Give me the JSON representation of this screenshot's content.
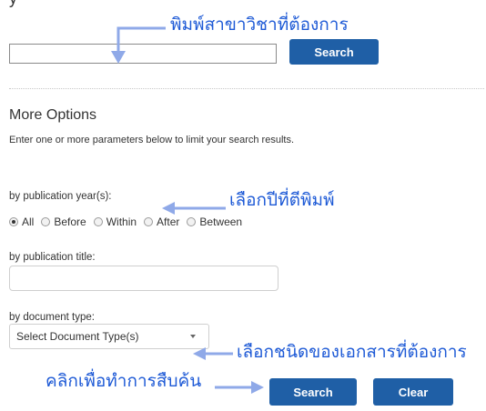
{
  "top": {
    "clipped_title": "y",
    "search_button": "Search"
  },
  "more_options": {
    "title": "More Options",
    "description": "Enter one or more parameters below to limit your search results."
  },
  "year": {
    "label": "by publication year(s):",
    "options": [
      "All",
      "Before",
      "Within",
      "After",
      "Between"
    ],
    "selected": "All"
  },
  "pub_title": {
    "label": "by publication title:",
    "value": ""
  },
  "doc_type": {
    "label": "by document type:",
    "selected": "Select Document Type(s)"
  },
  "actions": {
    "search": "Search",
    "clear": "Clear"
  },
  "annotations": {
    "subject": "พิมพ์สาขาวิชาที่ต้องการ",
    "year": "เลือกปีที่ตีพิมพ์",
    "doctype": "เลือกชนิดของเอกสารที่ต้องการ",
    "search": "คลิกเพื่อทำการสืบค้น"
  },
  "colors": {
    "button": "#1f5fa6",
    "annotation": "#1e5ad6"
  }
}
